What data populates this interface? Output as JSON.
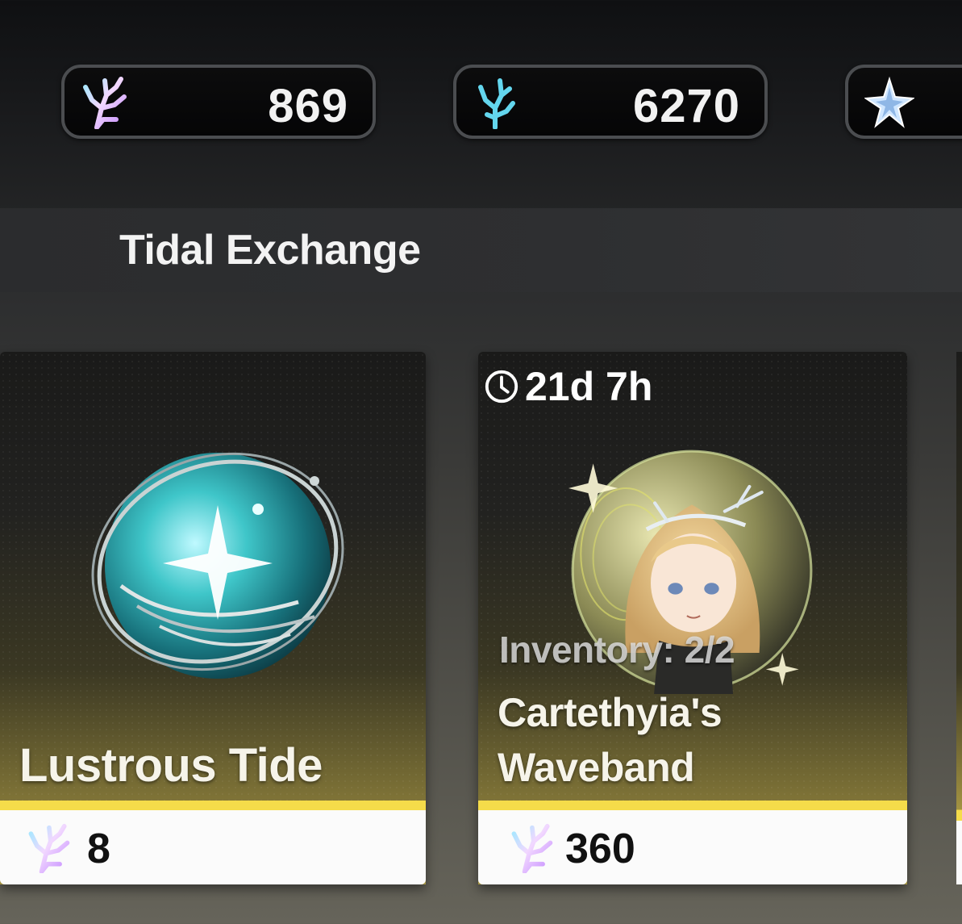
{
  "currencies": [
    {
      "icon": "coral-iridescent-icon",
      "amount": "869"
    },
    {
      "icon": "coral-cyan-icon",
      "amount": "6270"
    },
    {
      "icon": "star-crystal-icon",
      "amount": ""
    }
  ],
  "section": {
    "title": "Tidal Exchange"
  },
  "shop_items": [
    {
      "name": "Lustrous Tide",
      "image_icon": "lustrous-tide-orb-icon",
      "price_icon": "coral-iridescent-icon",
      "price": "8"
    },
    {
      "timer": "21d 7h",
      "timer_icon": "clock-icon",
      "inventory": "Inventory: 2/2",
      "name_line1": "Cartethyia's",
      "name_line2": "Waveband",
      "image_icon": "cartethyia-portrait-orb-icon",
      "price_icon": "coral-iridescent-icon",
      "price": "360"
    }
  ],
  "colors": {
    "accent_yellow": "#f5dc4a",
    "card_footer": "#fbfbfb",
    "pill_border": "#4b4d50"
  }
}
